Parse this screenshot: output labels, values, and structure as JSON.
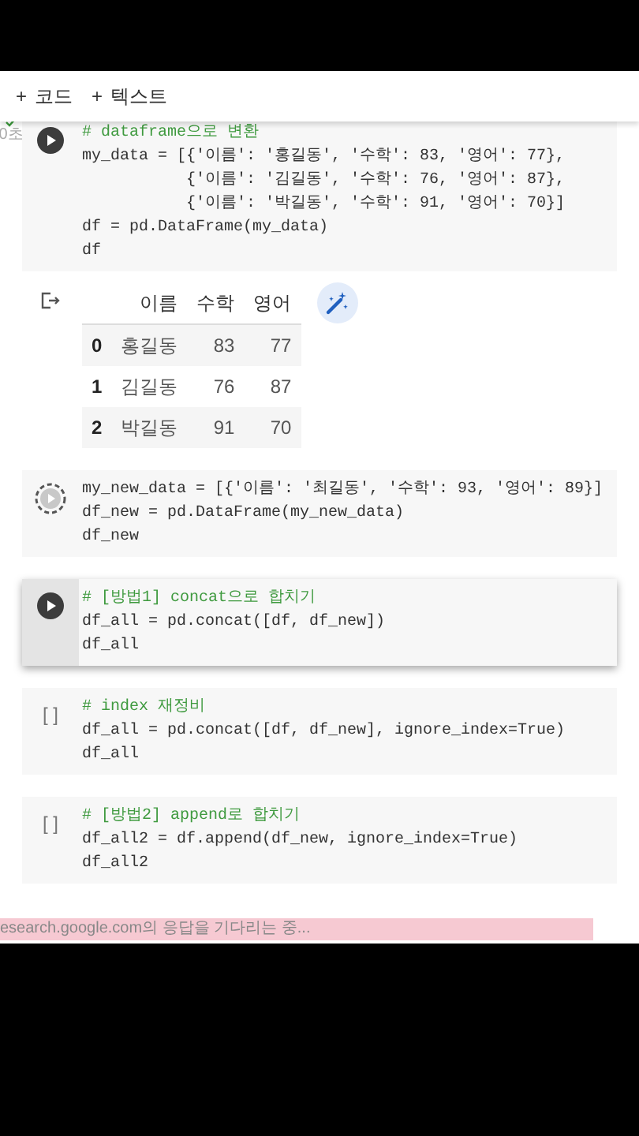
{
  "toolbar": {
    "buttons": [
      {
        "icon": "+",
        "label": "코드"
      },
      {
        "icon": "+",
        "label": "텍스트"
      }
    ]
  },
  "cells": [
    {
      "kind": "done",
      "focused": false,
      "exec_time": "0초",
      "lines": [
        {
          "kind": "comment",
          "text": "# dataframe으로 변환"
        },
        {
          "kind": "code",
          "text": "my_data = [{'이름': '홍길동', '수학': 83, '영어': 77},"
        },
        {
          "kind": "code",
          "text": "           {'이름': '김길동', '수학': 76, '영어': 87},"
        },
        {
          "kind": "code",
          "text": "           {'이름': '박길동', '수학': 91, '영어': 70}]"
        },
        {
          "kind": "code",
          "text": "df = pd.DataFrame(my_data)"
        },
        {
          "kind": "code",
          "text": "df"
        }
      ],
      "output": {
        "columns": [
          "",
          "이름",
          "수학",
          "영어"
        ],
        "rows": [
          [
            "0",
            "홍길동",
            "83",
            "77"
          ],
          [
            "1",
            "김길동",
            "76",
            "87"
          ],
          [
            "2",
            "박길동",
            "91",
            "70"
          ]
        ]
      }
    },
    {
      "kind": "pending",
      "focused": false,
      "lines": [
        {
          "kind": "code",
          "text": "my_new_data = [{'이름': '최길동', '수학': 93, '영어': 89}]"
        },
        {
          "kind": "code",
          "text": "df_new = pd.DataFrame(my_new_data)"
        },
        {
          "kind": "code",
          "text": "df_new"
        }
      ]
    },
    {
      "kind": "ready",
      "focused": true,
      "lines": [
        {
          "kind": "comment",
          "text": "# [방법1] concat으로 합치기"
        },
        {
          "kind": "code",
          "text": "df_all = pd.concat([df, df_new])"
        },
        {
          "kind": "code",
          "text": "df_all"
        }
      ]
    },
    {
      "kind": "idle",
      "focused": false,
      "idle_mark": "[ ]",
      "lines": [
        {
          "kind": "comment",
          "text": "# index 재정비"
        },
        {
          "kind": "code",
          "text": "df_all = pd.concat([df, df_new], ignore_index=True)"
        },
        {
          "kind": "code",
          "text": "df_all"
        }
      ]
    },
    {
      "kind": "idle",
      "focused": false,
      "idle_mark": "[ ]",
      "lines": [
        {
          "kind": "comment",
          "text": "# [방법2] append로 합치기"
        },
        {
          "kind": "code",
          "text": "df_all2 = df.append(df_new, ignore_index=True)"
        },
        {
          "kind": "code",
          "text": "df_all2"
        }
      ]
    }
  ],
  "status_bar": {
    "text": "esearch.google.com의 응답을 기다리는 중..."
  }
}
